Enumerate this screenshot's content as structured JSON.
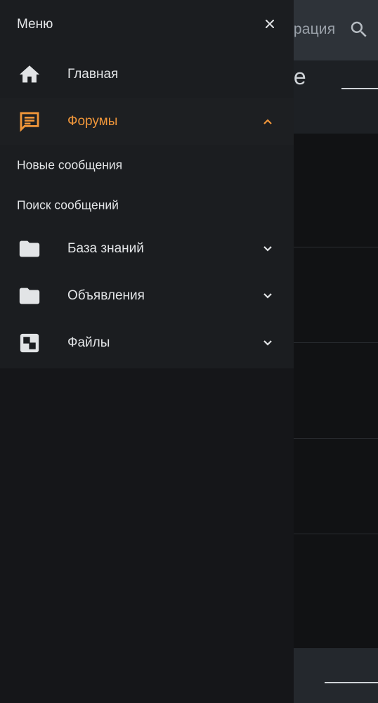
{
  "background": {
    "header_text": "трация",
    "page_title": "ие"
  },
  "drawer": {
    "title": "Меню",
    "items": [
      {
        "label": "Главная",
        "icon": "home-icon"
      },
      {
        "label": "Форумы",
        "icon": "forum-icon",
        "expanded": true,
        "children": [
          {
            "label": "Новые сообщения"
          },
          {
            "label": "Поиск сообщений"
          }
        ]
      },
      {
        "label": "База знаний",
        "icon": "folder-icon"
      },
      {
        "label": "Объявления",
        "icon": "folder-icon"
      },
      {
        "label": "Файлы",
        "icon": "media-icon"
      }
    ]
  },
  "colors": {
    "accent": "#f0963a",
    "drawer_bg": "#1b1d20",
    "text": "#e2e4e6"
  }
}
